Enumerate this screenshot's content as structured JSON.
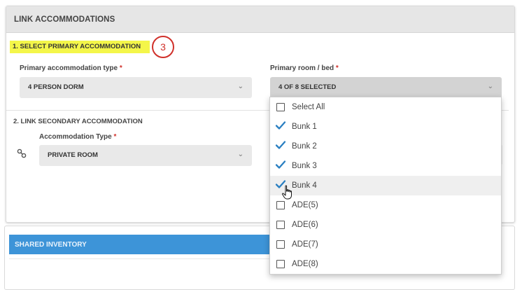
{
  "panel": {
    "title": "LINK ACCOMMODATIONS"
  },
  "step1": {
    "heading": "1. SELECT PRIMARY ACCOMMODATION",
    "badge": "3",
    "type_label": "Primary accommodation type",
    "type_value": "4 PERSON DORM",
    "room_label": "Primary room / bed",
    "room_value": "4 OF 8 SELECTED",
    "required_mark": "*"
  },
  "step2": {
    "heading": "2. LINK SECONDARY ACCOMMODATION",
    "type_label": "Accommodation Type",
    "type_value": "PRIVATE ROOM",
    "required_mark": "*"
  },
  "lower": {
    "title": "SHARED INVENTORY"
  },
  "dropdown": {
    "options": [
      {
        "label": "Select All",
        "checked": false
      },
      {
        "label": "Bunk 1",
        "checked": true
      },
      {
        "label": "Bunk 2",
        "checked": true
      },
      {
        "label": "Bunk 3",
        "checked": true
      },
      {
        "label": "Bunk 4",
        "checked": true
      },
      {
        "label": "ADE(5)",
        "checked": false
      },
      {
        "label": "ADE(6)",
        "checked": false
      },
      {
        "label": "ADE(7)",
        "checked": false
      },
      {
        "label": "ADE(8)",
        "checked": false
      }
    ]
  },
  "colors": {
    "accent": "#2a7fc1",
    "highlight": "#f4f64a",
    "badge": "#d0302a",
    "required": "#d0302a"
  },
  "icons": {
    "chevron": "chevron-down-icon",
    "link": "link-icon",
    "check": "check-icon",
    "cursor": "hand-pointer-icon"
  }
}
